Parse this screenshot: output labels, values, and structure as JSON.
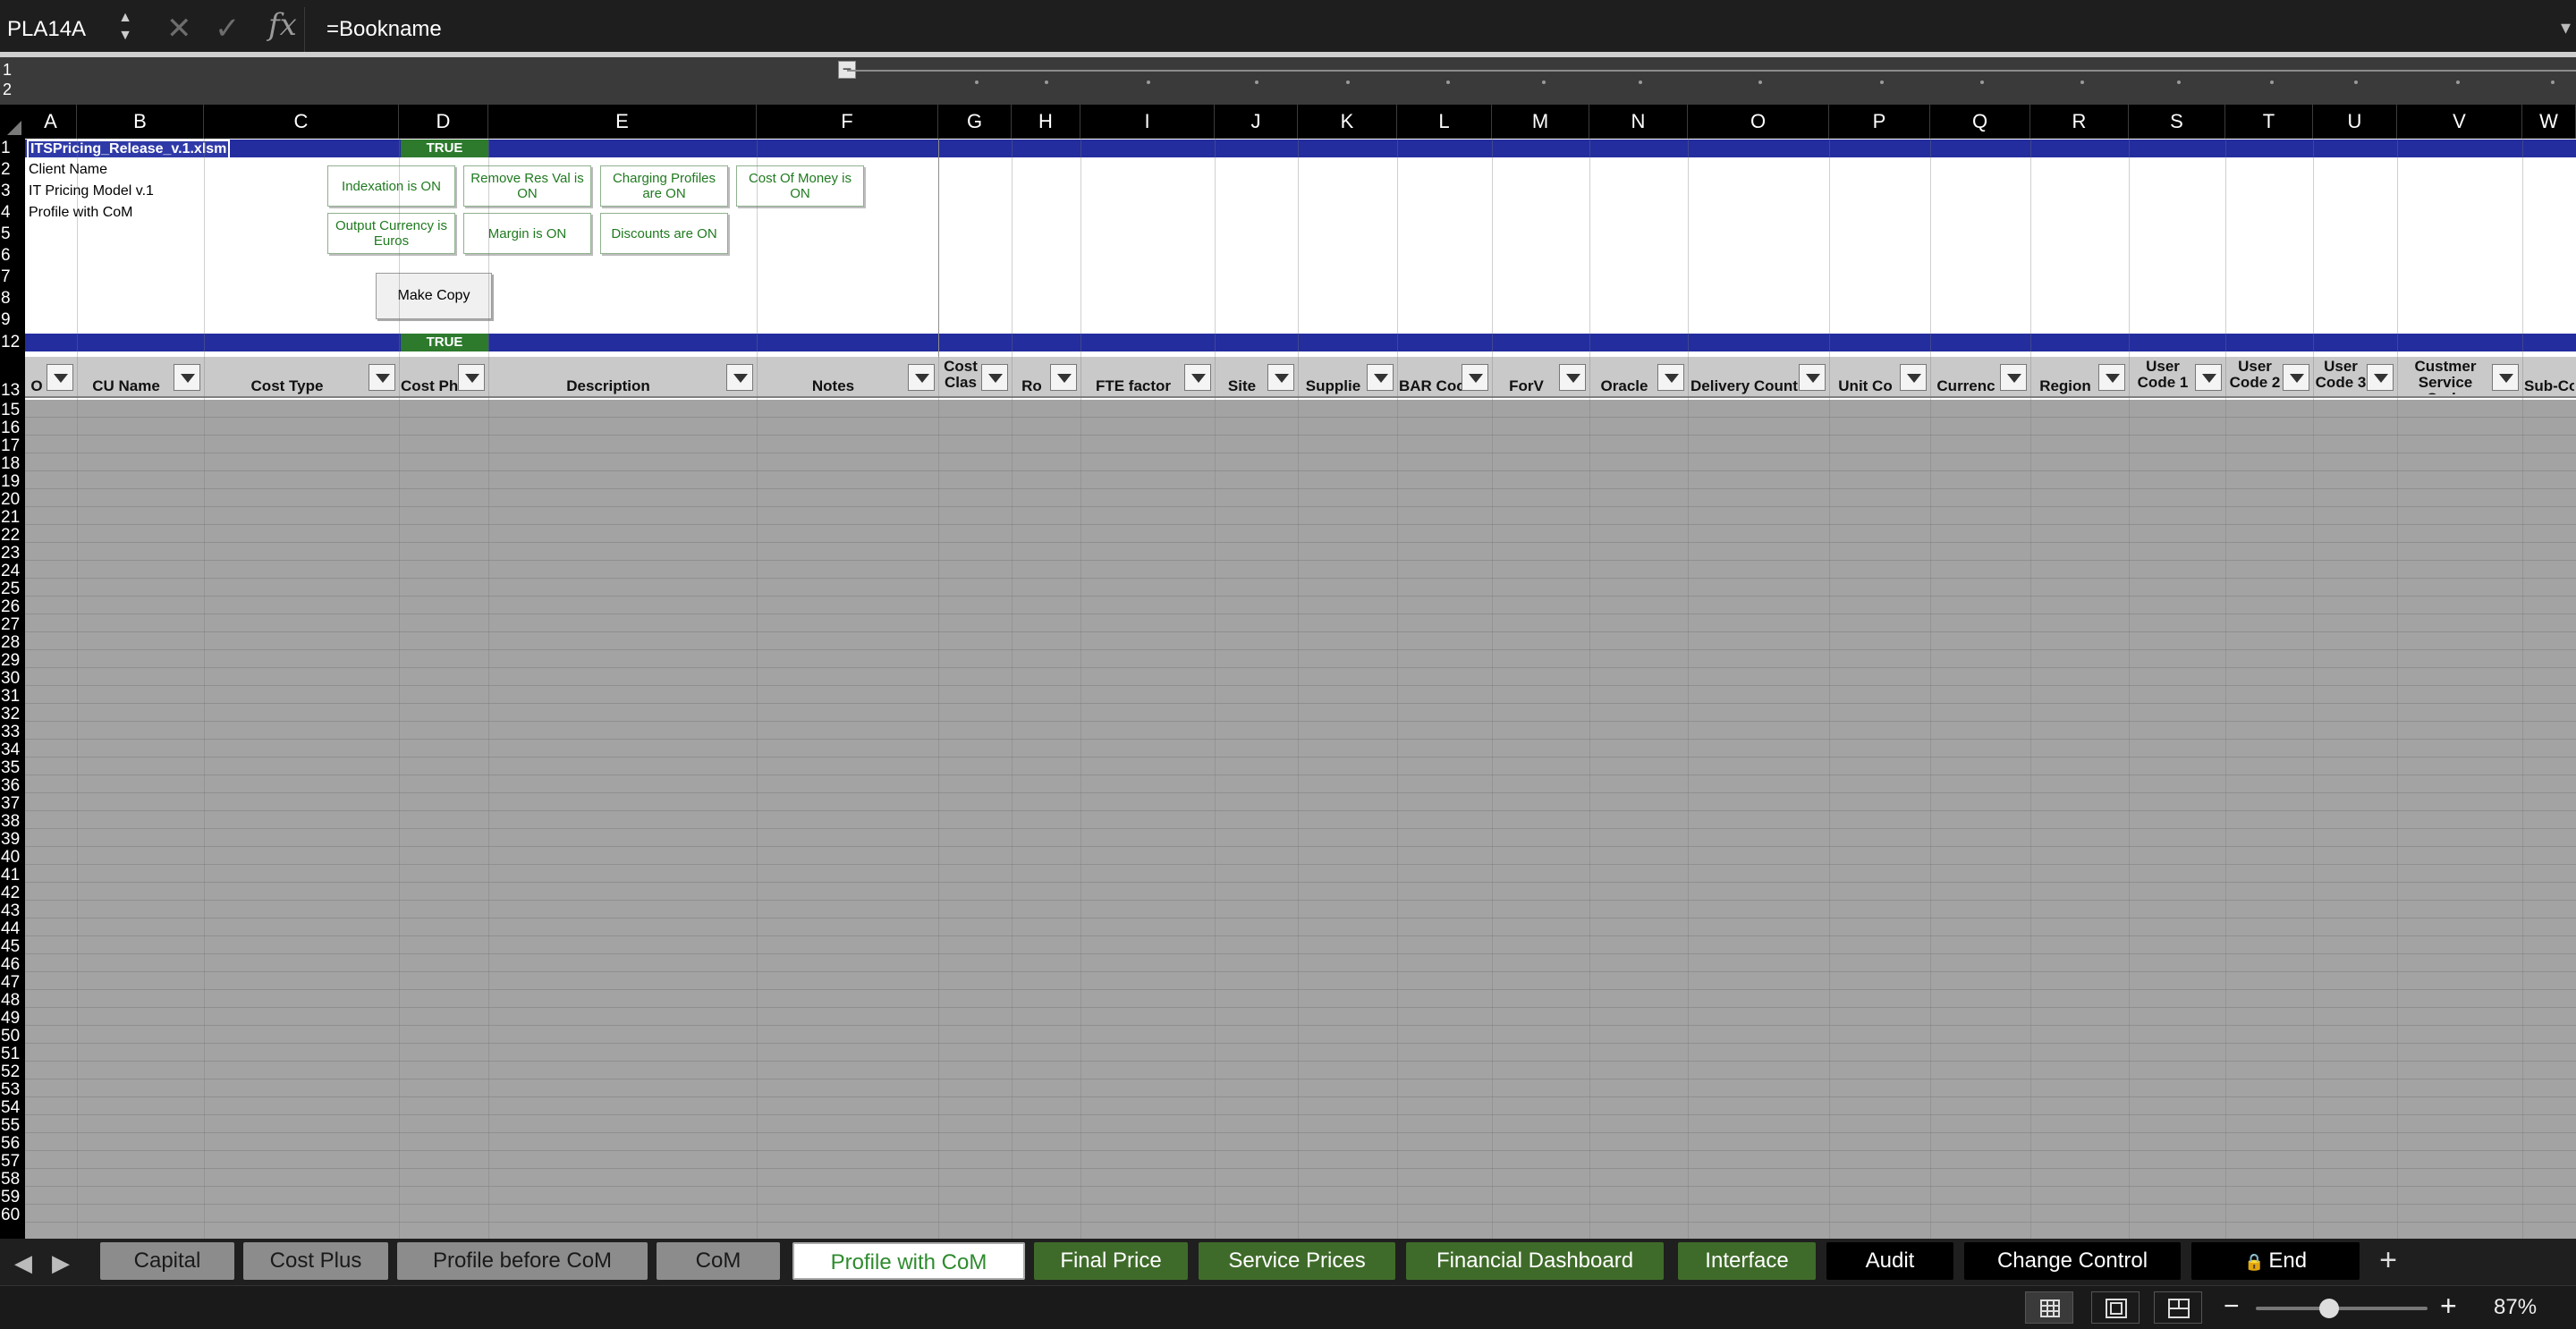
{
  "formula_bar": {
    "name_box": "PLA14A",
    "cancel_icon": "close-icon",
    "enter_icon": "check-icon",
    "fx_label": "fx",
    "formula": "=Bookname"
  },
  "outline": {
    "level1": "1",
    "level2": "2"
  },
  "columns": [
    "A",
    "B",
    "C",
    "D",
    "E",
    "F",
    "G",
    "H",
    "I",
    "J",
    "K",
    "L",
    "M",
    "N",
    "O",
    "P",
    "Q",
    "R",
    "S",
    "T",
    "U",
    "V",
    "W"
  ],
  "rows": [
    "1",
    "2",
    "3",
    "4",
    "5",
    "6",
    "7",
    "8",
    "9",
    "12",
    "13",
    "15",
    "16",
    "17",
    "18",
    "19",
    "20",
    "21",
    "22",
    "23",
    "24",
    "25",
    "26",
    "27",
    "28",
    "29",
    "30",
    "31",
    "32",
    "33",
    "34",
    "35",
    "36",
    "37",
    "38",
    "39",
    "40",
    "41",
    "42",
    "43",
    "44",
    "45",
    "46",
    "47",
    "48",
    "49",
    "50",
    "51",
    "52",
    "53",
    "54",
    "55",
    "56",
    "57",
    "58",
    "59",
    "60"
  ],
  "sheet": {
    "a1": "ITSPricing_Release_v.1.xlsm",
    "a2": "Client Name",
    "a3": "IT Pricing Model v.1",
    "a4": "Profile with CoM",
    "d1": "TRUE",
    "d12": "TRUE",
    "toggles": {
      "indexation": "Indexation is ON",
      "res_val": "Remove Res Val is ON",
      "charging_profiles": "Charging Profiles are ON",
      "cost_of_money": "Cost Of Money is ON",
      "output_currency": "Output Currency is Euros",
      "margin": "Margin is ON",
      "discounts": "Discounts are ON"
    },
    "make_copy": "Make Copy"
  },
  "header_row": {
    "a": "O",
    "b": "CU Name",
    "c": "Cost Type",
    "d": "Cost Ph",
    "e": "Description",
    "f": "Notes",
    "g": "Cost Clas",
    "h": "Ro",
    "i": "FTE factor",
    "j": "Site",
    "k": "Supplie",
    "l": "BAR Coo",
    "m": "ForV",
    "n": "Oracle",
    "o": "Delivery Count",
    "p": "Unit Co",
    "q": "Currenc",
    "r": "Region",
    "s": "User Code 1",
    "t": "User Code 2",
    "u": "User Code 3",
    "v": "Custmer Service Code",
    "w": "Sub-Co"
  },
  "tabs": [
    {
      "label": "Capital",
      "bg": "#8c8c8c",
      "fg": "#1a1a1a"
    },
    {
      "label": "Cost Plus",
      "bg": "#8c8c8c",
      "fg": "#1a1a1a"
    },
    {
      "label": "Profile before CoM",
      "bg": "#8c8c8c",
      "fg": "#1a1a1a"
    },
    {
      "label": "CoM",
      "bg": "#8c8c8c",
      "fg": "#1a1a1a"
    },
    {
      "label": "Profile with CoM",
      "bg": "#ffffff",
      "fg": "#2e8b2e"
    },
    {
      "label": "Final Price",
      "bg": "#3f6b2a",
      "fg": "#ffffff"
    },
    {
      "label": "Service Prices",
      "bg": "#3f6b2a",
      "fg": "#ffffff"
    },
    {
      "label": "Financial Dashboard",
      "bg": "#3f6b2a",
      "fg": "#ffffff"
    },
    {
      "label": "Interface",
      "bg": "#3f6b2a",
      "fg": "#ffffff"
    },
    {
      "label": "Audit",
      "bg": "#000000",
      "fg": "#ffffff"
    },
    {
      "label": "Change Control",
      "bg": "#000000",
      "fg": "#ffffff"
    },
    {
      "label": "End",
      "bg": "#000000",
      "fg": "#ffffff"
    }
  ],
  "status": {
    "views": [
      "normal-view-icon",
      "page-layout-icon",
      "page-break-icon"
    ],
    "zoom_out": "−",
    "zoom_in": "+",
    "zoom": "87%",
    "zoom_level": 0.87
  },
  "colors": {
    "band": "#232d9e",
    "true_green": "#2d7a2d",
    "toggle_text": "#1f7a1f"
  }
}
